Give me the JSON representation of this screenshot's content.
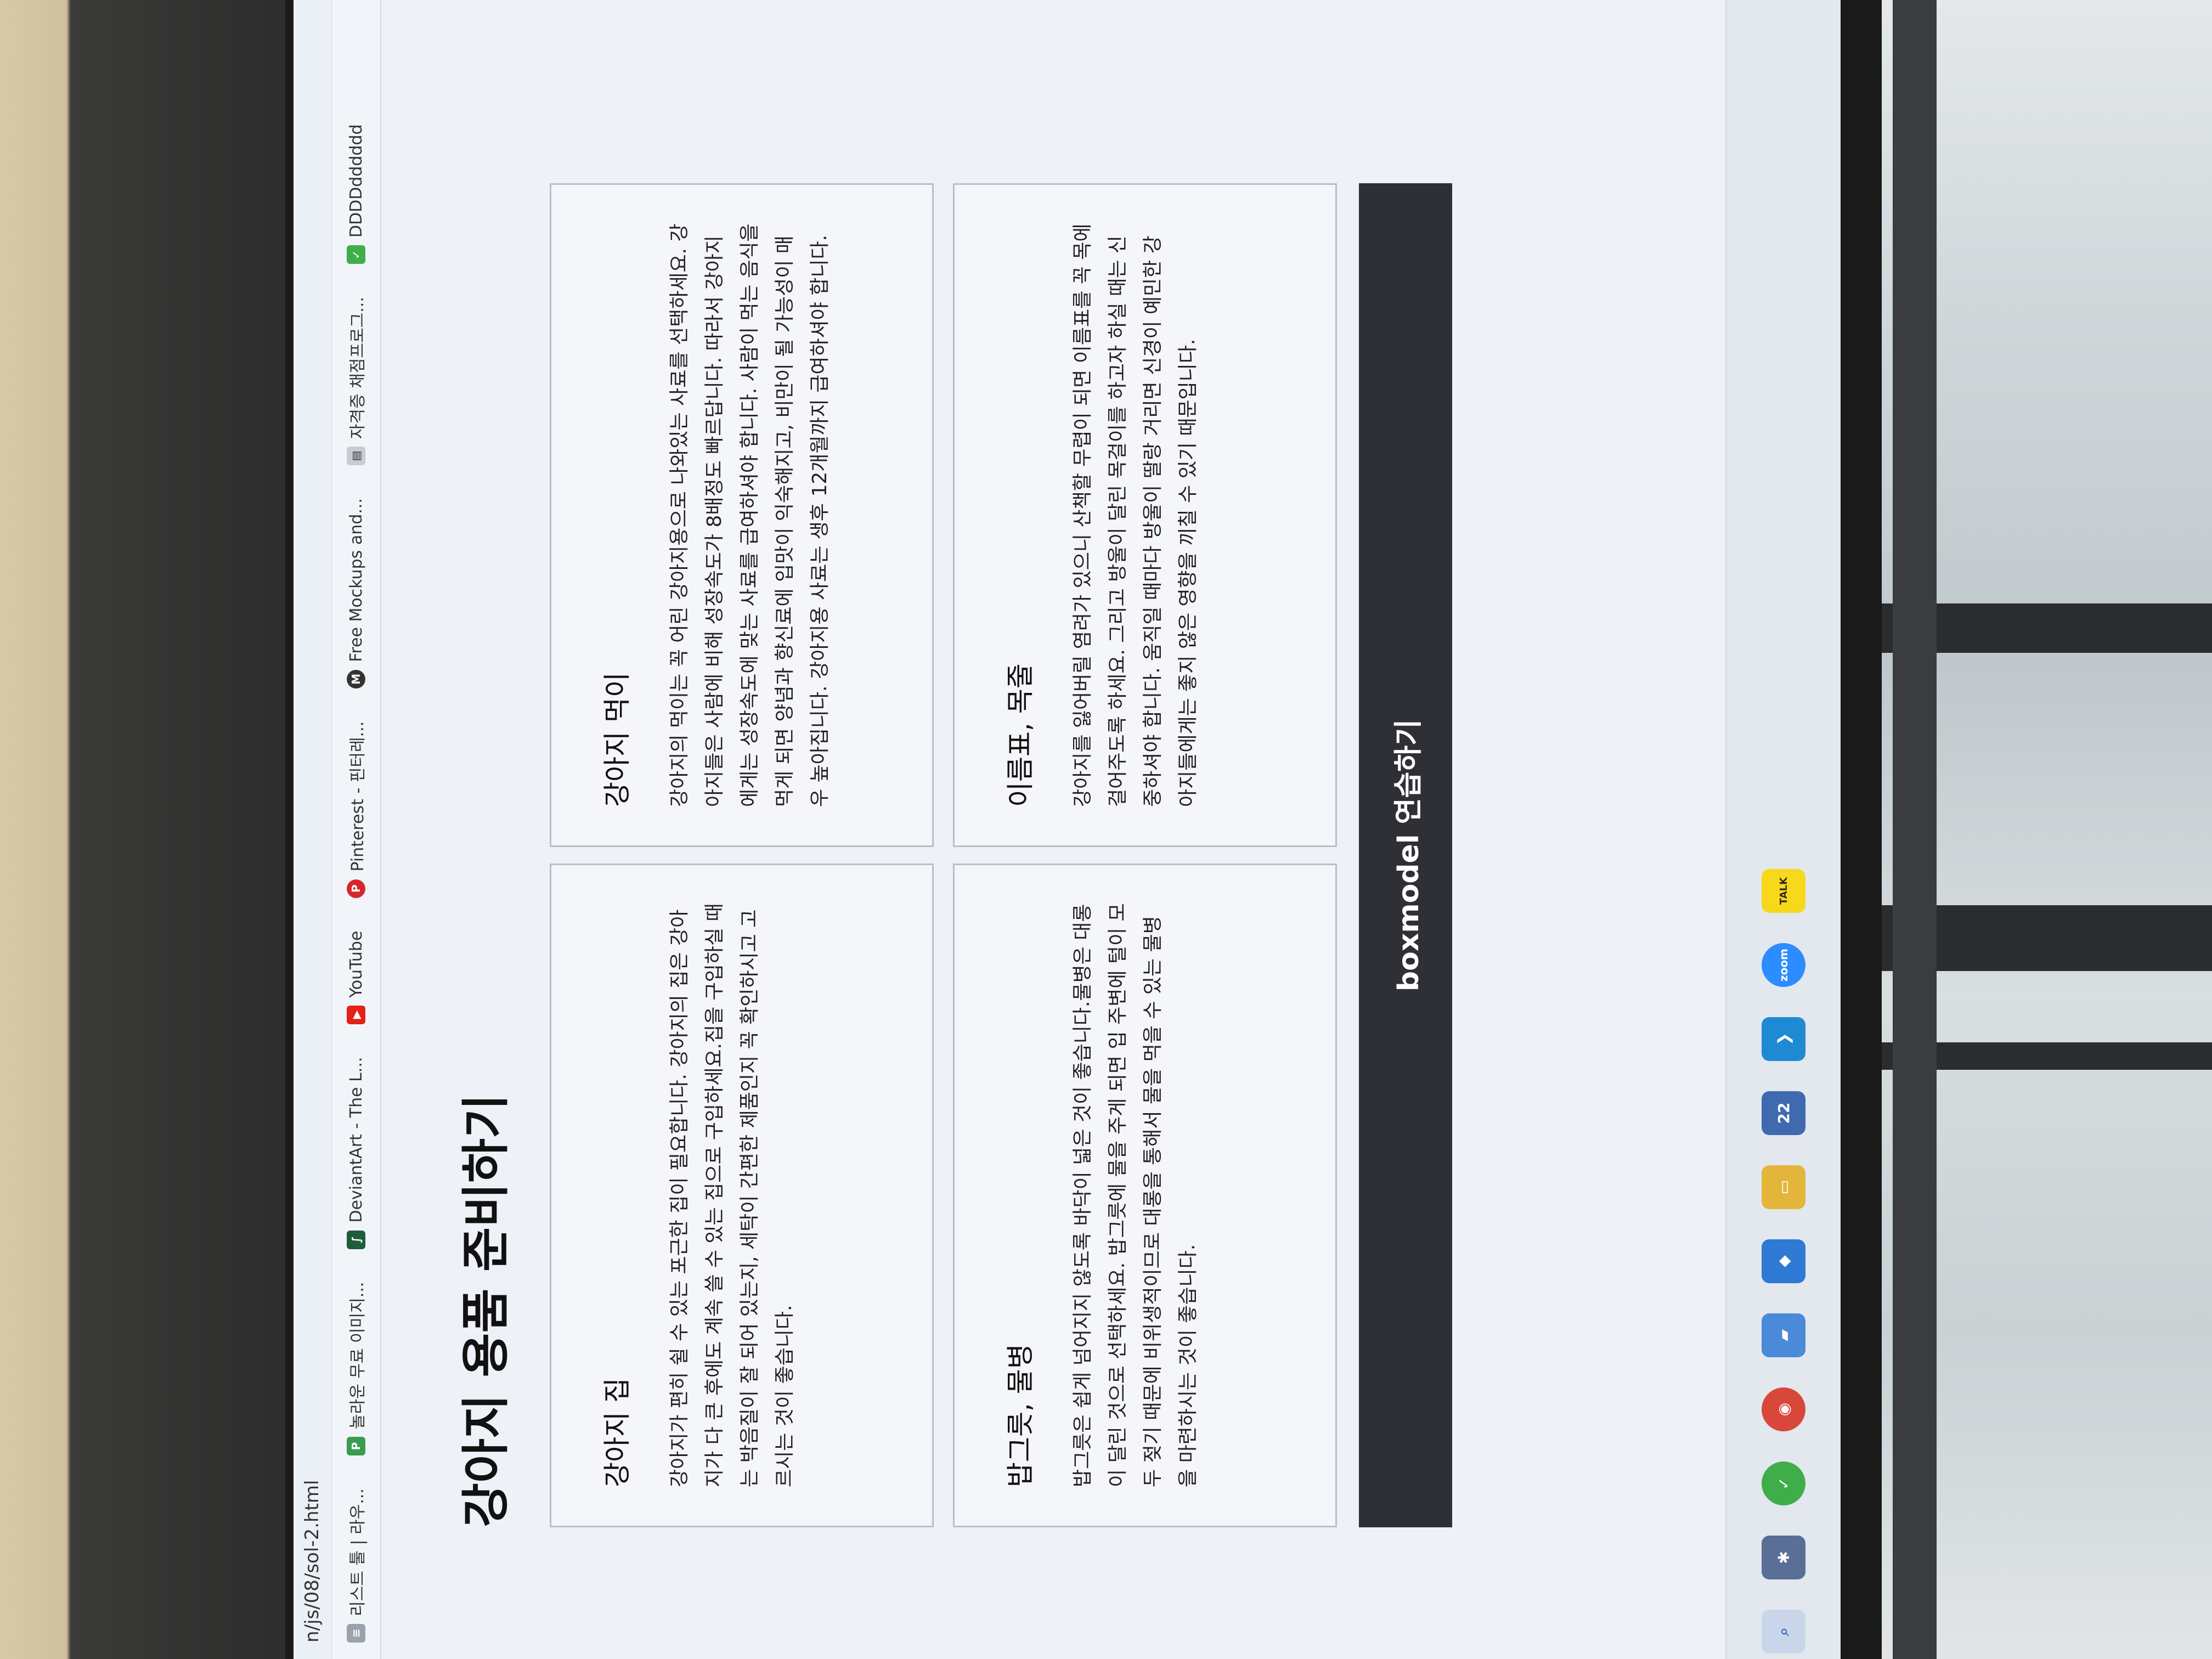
{
  "browser": {
    "url": "n/js/08/sol-2.html",
    "bookmarks": [
      {
        "label": "리스트 툴 | 라우...",
        "icon": "list-icon"
      },
      {
        "label": "놀라운 무료 이미지...",
        "icon": "image-icon"
      },
      {
        "label": "DeviantArt - The L...",
        "icon": "deviantart-icon"
      },
      {
        "label": "YouTube",
        "icon": "youtube-icon"
      },
      {
        "label": "Pinterest - 핀터레...",
        "icon": "pinterest-icon"
      },
      {
        "label": "Free Mockups and...",
        "icon": "mockup-icon"
      },
      {
        "label": "자격증 채점프로그...",
        "icon": "document-icon"
      },
      {
        "label": "DDDDdddddd",
        "icon": "bookmark-green-icon"
      }
    ]
  },
  "page": {
    "title": "강아지 용품 준비하기",
    "cards": [
      {
        "heading": "강아지 집",
        "body": "강아지가 편히 쉴 수 있는 포근한 집이 필요합니다. 강아지의 집은 강아지가 다 큰 후에도 계속 쓸 수 있는 집으로 구입하세요.집을 구입하실 때는 박음질이 잘 되어 있는지, 세탁이 간편한 제품인지 꼭 확인하시고 고르시는 것이 좋습니다."
      },
      {
        "heading": "강아지 먹이",
        "body": "강아지의 먹이는 꼭 어린 강아지용으로 나와있는 사료를 선택하세요. 강아지들은 사람에 비해 성장속도가 8배정도 빠르답니다. 따라서 강아지에게는 성장속도에 맞는 사료를 급여하셔야 합니다. 사람이 먹는 음식을 먹게 되면 양념과 향신료에 입맛이 익숙해지고, 비만이 될 가능성이 매우 높아집니다. 강아지용 사료는 생후 12개월까지 급여하셔야 합니다."
      },
      {
        "heading": "밥그릇, 물병",
        "body": "밥그릇은 쉽게 넘어지지 않도록 바닥이 넓은 것이 좋습니다.물병은 대롱이 달린 것으로 선택하세요. 밥그릇에 물을 주게 되면 입 주변에 털이 모두 젖기 때문에 비위생적이므로 대롱을 통해서 물을 먹을 수 있는 물병을 마련하시는 것이 좋습니다."
      },
      {
        "heading": "이름표, 목줄",
        "body": "강아지를 잃어버릴 염려가 있으니 산책할 무렵이 되면 이름표를 꼭 목에 걸어주도록 하세요. 그리고 방울이 달린 목걸이를 하고자 하실 때는 신중하셔야 합니다. 움직일 때마다 방울이 딸랑 거리면 신경이 예민한 강아지들에게는 좋지 않은 영향을 끼칠 수 있기 때문입니다."
      }
    ],
    "footer": "boxmodel 연습하기"
  },
  "taskbar": {
    "icons": [
      {
        "name": "search-icon",
        "glyph": "⌕",
        "color": "#3b6fb6"
      },
      {
        "name": "app-icon",
        "glyph": "✱",
        "color": "#5a6f96"
      },
      {
        "name": "check-app-icon",
        "glyph": "✓",
        "color": "#3fae4a"
      },
      {
        "name": "chrome-icon",
        "glyph": "◉",
        "color": "#d9473b"
      },
      {
        "name": "app-blue-icon",
        "glyph": "▰",
        "color": "#4a8ad8"
      },
      {
        "name": "app-cube-icon",
        "glyph": "◆",
        "color": "#2f7ad4"
      },
      {
        "name": "folder-icon",
        "glyph": "▭",
        "color": "#e3b53b"
      },
      {
        "name": "app-2022-icon",
        "glyph": "22",
        "color": "#3f6ab0"
      },
      {
        "name": "vscode-icon",
        "glyph": "❯",
        "color": "#1f8ad4"
      },
      {
        "name": "zoom-icon",
        "glyph": "zoom",
        "color": "#2d8cff"
      },
      {
        "name": "kakaotalk-icon",
        "glyph": "TALK",
        "color": "#f7d81b"
      }
    ]
  }
}
